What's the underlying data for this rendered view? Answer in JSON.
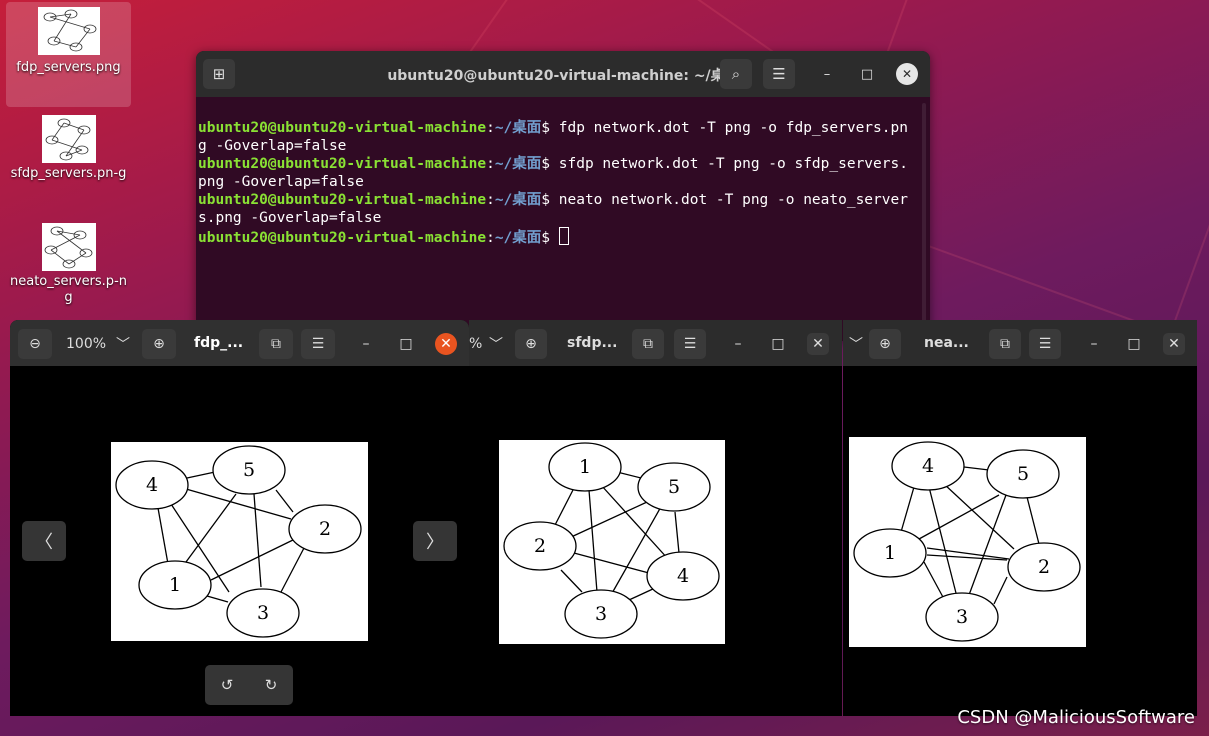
{
  "desktop": {
    "icons": [
      {
        "label": "fdp_servers.png"
      },
      {
        "label": "sfdp_servers.pn-g"
      },
      {
        "label": "neato_servers.p-ng"
      }
    ]
  },
  "terminal": {
    "title": "ubuntu20@ubuntu20-virtual-machine: ~/桌面",
    "prompt_user": "ubuntu20@ubuntu20-virtual-machine",
    "prompt_sep": ":",
    "prompt_path": "~/桌面",
    "prompt_sign": "$ ",
    "commands": [
      "fdp network.dot -T png -o fdp_servers.png -Goverlap=false",
      "sfdp network.dot -T png -o sfdp_servers.png -Goverlap=false",
      "neato network.dot -T png -o neato_servers.png -Goverlap=false"
    ]
  },
  "viewers": [
    {
      "title": "fdp_...",
      "zoom": "100%"
    },
    {
      "title": "sfdp...",
      "zoom": "%"
    },
    {
      "title": "nea..."
    }
  ],
  "graphs": {
    "fdp": {
      "nodes": [
        "4",
        "5",
        "2",
        "1",
        "3"
      ]
    },
    "sfdp": {
      "nodes": [
        "1",
        "5",
        "2",
        "4",
        "3"
      ]
    },
    "neato": {
      "nodes": [
        "4",
        "5",
        "1",
        "2",
        "3"
      ]
    }
  },
  "watermark": "CSDN @MaliciousSoftware"
}
